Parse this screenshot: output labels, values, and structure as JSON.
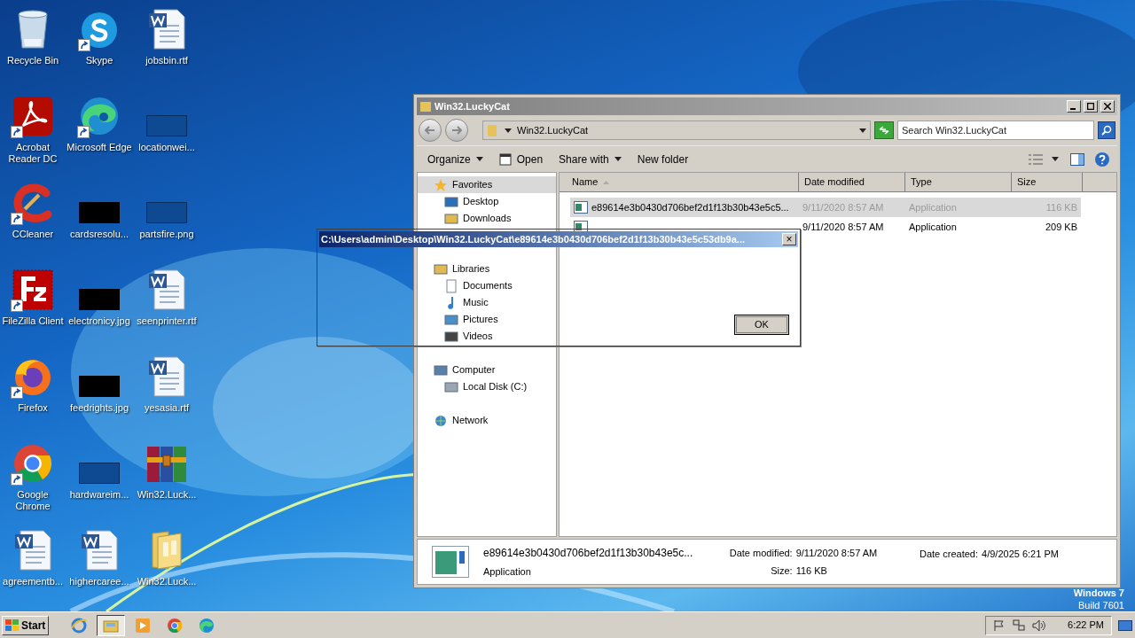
{
  "desktop_icons": [
    {
      "label": "Recycle Bin",
      "kind": "recycle",
      "shortcut": false
    },
    {
      "label": "Skype",
      "kind": "skype",
      "shortcut": true
    },
    {
      "label": "jobsbin.rtf",
      "kind": "word",
      "shortcut": false
    },
    {
      "label": "Acrobat Reader DC",
      "kind": "acrobat",
      "shortcut": true
    },
    {
      "label": "Microsoft Edge",
      "kind": "edge",
      "shortcut": true
    },
    {
      "label": "locationwei...",
      "kind": "blank",
      "shortcut": false
    },
    {
      "label": "CCleaner",
      "kind": "ccleaner",
      "shortcut": true
    },
    {
      "label": "cardsresolu...",
      "kind": "black",
      "shortcut": false
    },
    {
      "label": "partsfire.png",
      "kind": "blank",
      "shortcut": false
    },
    {
      "label": "FileZilla Client",
      "kind": "filezilla",
      "shortcut": true
    },
    {
      "label": "electronicy.jpg",
      "kind": "black",
      "shortcut": false
    },
    {
      "label": "seenprinter.rtf",
      "kind": "word",
      "shortcut": false
    },
    {
      "label": "Firefox",
      "kind": "firefox",
      "shortcut": true
    },
    {
      "label": "feedrights.jpg",
      "kind": "black",
      "shortcut": false
    },
    {
      "label": "yesasia.rtf",
      "kind": "word",
      "shortcut": false
    },
    {
      "label": "Google Chrome",
      "kind": "chrome",
      "shortcut": true
    },
    {
      "label": "hardwareim...",
      "kind": "blank",
      "shortcut": false
    },
    {
      "label": "Win32.Luck...",
      "kind": "winrar",
      "shortcut": false
    },
    {
      "label": "agreementb...",
      "kind": "word",
      "shortcut": false
    },
    {
      "label": "highercaree...",
      "kind": "word",
      "shortcut": false
    },
    {
      "label": "Win32.Luck...",
      "kind": "folder",
      "shortcut": false
    }
  ],
  "explorer": {
    "title": "Win32.LuckyCat",
    "address": "Win32.LuckyCat",
    "search_placeholder": "Search Win32.LuckyCat",
    "toolbar": [
      {
        "label": "Organize",
        "kind": "menu"
      },
      {
        "label": "Open",
        "kind": "open"
      },
      {
        "label": "Share with",
        "kind": "menu"
      },
      {
        "label": "New folder",
        "kind": "plain"
      }
    ],
    "nav": [
      {
        "label": "Favorites",
        "kind": "star",
        "selected": true,
        "children": [
          {
            "label": "Desktop",
            "kind": "desktop",
            "selected": false
          },
          {
            "label": "Downloads",
            "kind": "folder",
            "selected": false
          }
        ]
      },
      {
        "label": "Libraries",
        "kind": "library",
        "selected": false,
        "children": [
          {
            "label": "Documents",
            "kind": "document",
            "selected": false
          },
          {
            "label": "Music",
            "kind": "music",
            "selected": false
          },
          {
            "label": "Pictures",
            "kind": "picture",
            "selected": false
          },
          {
            "label": "Videos",
            "kind": "video",
            "selected": false
          }
        ]
      },
      {
        "label": "Computer",
        "kind": "computer",
        "selected": false,
        "children": [
          {
            "label": "Local Disk (C:)",
            "kind": "disk",
            "selected": false
          }
        ]
      },
      {
        "label": "Network",
        "kind": "network",
        "selected": false
      }
    ],
    "columns": [
      "Name",
      "Date modified",
      "Type",
      "Size"
    ],
    "files": [
      {
        "name": "e89614e3b0430d706bef2d1f13b30b43e5c5...",
        "date": "9/11/2020 8:57 AM",
        "type": "Application",
        "size": "116 KB",
        "selected": true
      },
      {
        "date": "9/11/2020 8:57 AM",
        "type": "Application",
        "size": "209 KB",
        "selected": false
      }
    ],
    "status": {
      "name": "e89614e3b0430d706bef2d1f13b30b43e5c...",
      "type": "Application",
      "modified_label": "Date modified:",
      "modified": "9/11/2020 8:57 AM",
      "size_label": "Size:",
      "size": "116 KB",
      "created_label": "Date created:",
      "created": "4/9/2025 6:21 PM"
    }
  },
  "dialog": {
    "title": "C:\\Users\\admin\\Desktop\\Win32.LuckyCat\\e89614e3b0430d706bef2d1f13b30b43e5c53db9a...",
    "close": "×",
    "button": "OK"
  },
  "os_label": [
    "Windows 7",
    "Build 7601"
  ],
  "taskbar": {
    "start": "Start",
    "apps": [
      {
        "kind": "ie",
        "active": false
      },
      {
        "kind": "explorer",
        "active": true
      },
      {
        "kind": "media",
        "active": false
      },
      {
        "kind": "chrome",
        "active": false
      },
      {
        "kind": "edge",
        "active": false
      }
    ],
    "time": "6:22 PM"
  }
}
